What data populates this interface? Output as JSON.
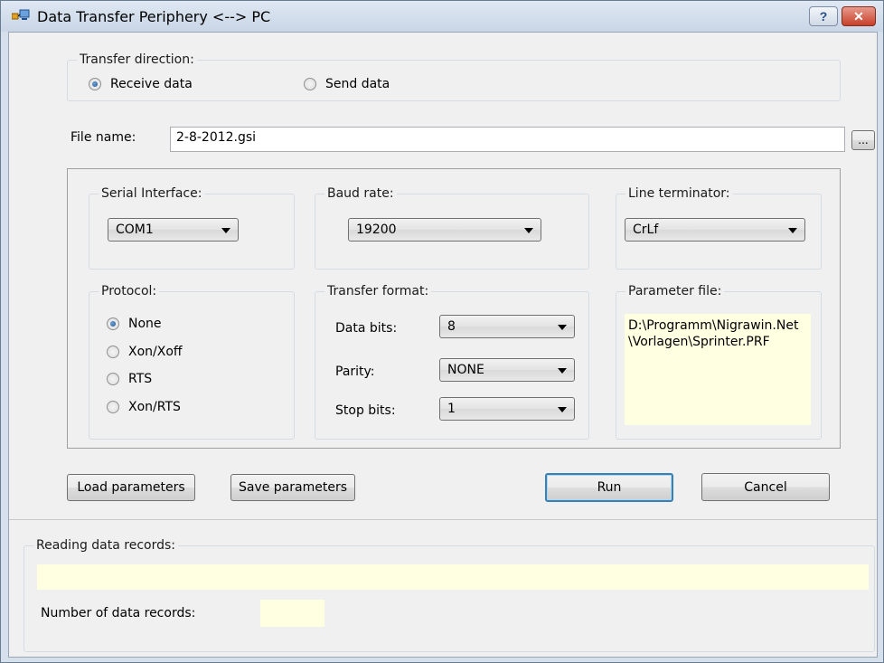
{
  "window": {
    "title": "Data Transfer Periphery <--> PC",
    "help_label": "?",
    "close_label": "✕"
  },
  "transfer_direction": {
    "legend": "Transfer direction:",
    "options": [
      {
        "label": "Receive data",
        "checked": true
      },
      {
        "label": "Send data",
        "checked": false
      }
    ]
  },
  "file": {
    "label": "File name:",
    "value": "2-8-2012.gsi",
    "browse_label": "..."
  },
  "serial_interface": {
    "legend": "Serial Interface:",
    "value": "COM1"
  },
  "baud_rate": {
    "legend": "Baud rate:",
    "value": "19200"
  },
  "line_terminator": {
    "legend": "Line terminator:",
    "value": "CrLf"
  },
  "protocol": {
    "legend": "Protocol:",
    "options": [
      {
        "label": "None",
        "checked": true
      },
      {
        "label": "Xon/Xoff",
        "checked": false
      },
      {
        "label": "RTS",
        "checked": false
      },
      {
        "label": "Xon/RTS",
        "checked": false
      }
    ]
  },
  "transfer_format": {
    "legend": "Transfer format:",
    "data_bits_label": "Data bits:",
    "data_bits": "8",
    "parity_label": "Parity:",
    "parity": "NONE",
    "stop_bits_label": "Stop bits:",
    "stop_bits": "1"
  },
  "parameter_file": {
    "legend": "Parameter file:",
    "path": "D:\\Programm\\Nigrawin.Net \\Vorlagen\\Sprinter.PRF"
  },
  "buttons": {
    "load": "Load parameters",
    "save": "Save parameters",
    "run": "Run",
    "cancel": "Cancel"
  },
  "reading": {
    "legend": "Reading data records:",
    "count_label": "Number of data records:",
    "progress": "",
    "count": ""
  },
  "colors": {
    "info_background": "#ffffe1",
    "default_button_border": "#3c7fb1"
  }
}
